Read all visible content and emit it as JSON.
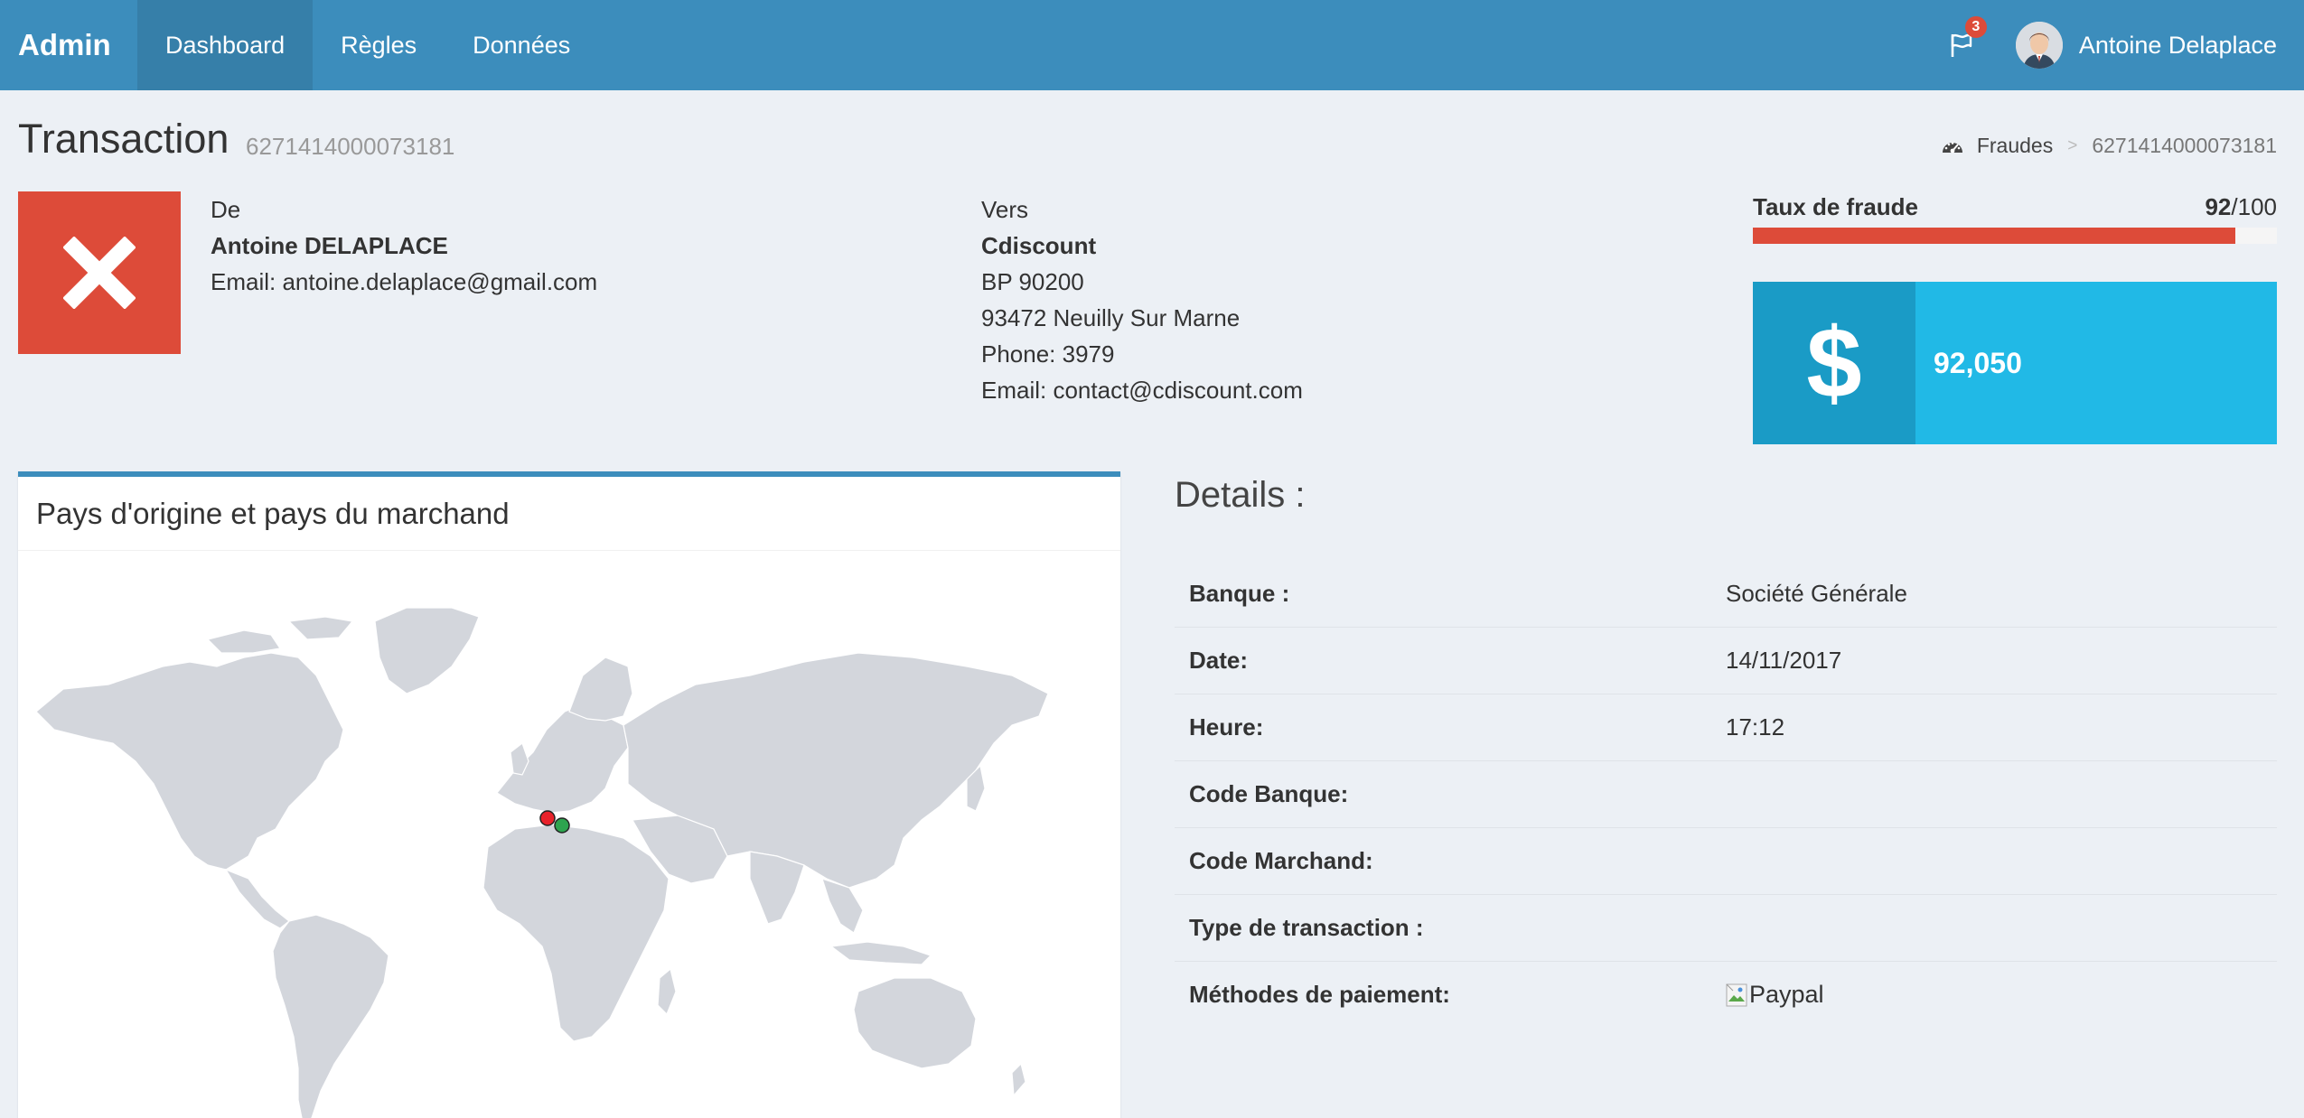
{
  "nav": {
    "brand": "Admin",
    "items": [
      {
        "label": "Dashboard"
      },
      {
        "label": "Règles"
      },
      {
        "label": "Données"
      }
    ],
    "notification_count": "3",
    "user_name": "Antoine Delaplace"
  },
  "header": {
    "title": "Transaction",
    "transaction_id": "6271414000073181",
    "breadcrumb": [
      "Fraudes",
      "6271414000073181"
    ]
  },
  "from": {
    "label": "De",
    "name": "Antoine DELAPLACE",
    "email": "Email: antoine.delaplace@gmail.com"
  },
  "to": {
    "label": "Vers",
    "name": "Cdiscount",
    "address1": "BP 90200",
    "address2": "93472 Neuilly Sur Marne",
    "phone": "Phone: 3979",
    "email": "Email: contact@cdiscount.com"
  },
  "fraud": {
    "label": "Taux de fraude",
    "score": "92",
    "max": "/100",
    "fraction": 0.92
  },
  "amount": {
    "icon": "dollar-icon",
    "value": "92,050"
  },
  "map_panel": {
    "title": "Pays d'origine et pays du marchand",
    "markers": [
      {
        "name": "origin",
        "color": "#e8222b"
      },
      {
        "name": "merchant",
        "color": "#2ea44f"
      }
    ]
  },
  "details": {
    "title": "Details :",
    "rows": [
      {
        "label": "Banque :",
        "value": "Société Générale"
      },
      {
        "label": "Date:",
        "value": "14/11/2017"
      },
      {
        "label": "Heure:",
        "value": "17:12"
      },
      {
        "label": "Code Banque:",
        "value": ""
      },
      {
        "label": "Code Marchand:",
        "value": ""
      },
      {
        "label": "Type de transaction :",
        "value": ""
      },
      {
        "label": "Méthodes de paiement:",
        "value": "Paypal"
      }
    ]
  },
  "colors": {
    "primary": "#3c8dbc",
    "danger": "#dd4b39",
    "info": "#21b9e6"
  }
}
